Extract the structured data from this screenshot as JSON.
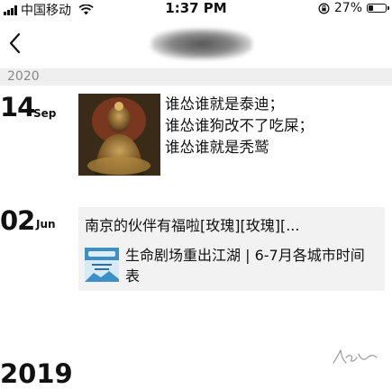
{
  "status_bar": {
    "carrier": "中国移动",
    "time": "1:37 PM",
    "battery_percent": "27%",
    "battery_level": 0.27
  },
  "nav": {
    "back_icon": "chevron-left-icon"
  },
  "year_header": "2020",
  "moments": [
    {
      "day": "14",
      "month": "Sep",
      "text_lines": [
        "谁怂谁就是泰迪；",
        "谁怂谁狗改不了吃屎；",
        "谁怂谁就是秃鹫"
      ]
    },
    {
      "day": "02",
      "month": "Jun",
      "share_title": "南京的伙伴有福啦[玫瑰][玫瑰][...",
      "article_title": "生命剧场重出江湖 | 6-7月各城市时间表"
    }
  ],
  "next_year_header": "2019"
}
